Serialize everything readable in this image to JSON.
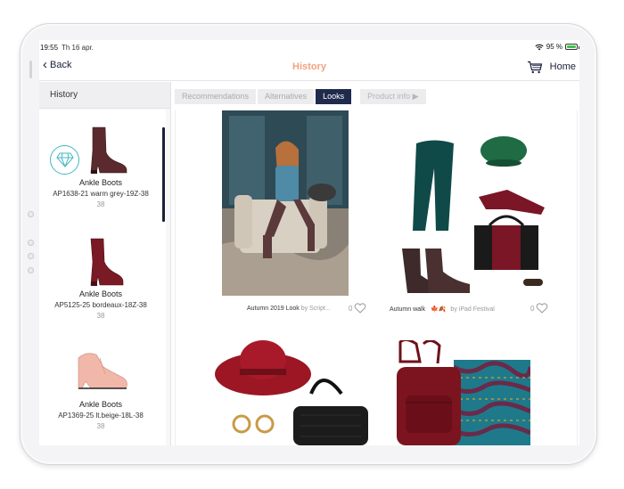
{
  "status": {
    "time": "19:55",
    "date": "Th 16 apr.",
    "battery": "95 %"
  },
  "nav": {
    "back_label": "Back",
    "title": "History",
    "home_label": "Home"
  },
  "sidebar": {
    "header": "History",
    "items": [
      {
        "name": "Ankle Boots",
        "code": "AP1638-21 warm grey-19Z-38",
        "size": "38"
      },
      {
        "name": "Ankle Boots",
        "code": "AP5125-25 bordeaux-18Z-38",
        "size": "38"
      },
      {
        "name": "Ankle Boots",
        "code": "AP1369-25 lt.beige-18L-38",
        "size": "38"
      }
    ]
  },
  "tabs": [
    {
      "label": "Recommendations",
      "state": "inactive"
    },
    {
      "label": "Alternatives",
      "state": "inactive"
    },
    {
      "label": "Looks",
      "state": "active"
    },
    {
      "label": "Product info ▶",
      "state": "disabled"
    }
  ],
  "looks": [
    {
      "title": "Autumn 2019 Look",
      "by": "by Script...",
      "likes": "0"
    },
    {
      "title": "Autumn walk",
      "emoji": "🍁🍂",
      "by": "by iPad Festival",
      "likes": "0"
    }
  ],
  "colors": {
    "accent": "#1f2a4d",
    "title": "#f2a380",
    "badge": "#43b7c4"
  }
}
